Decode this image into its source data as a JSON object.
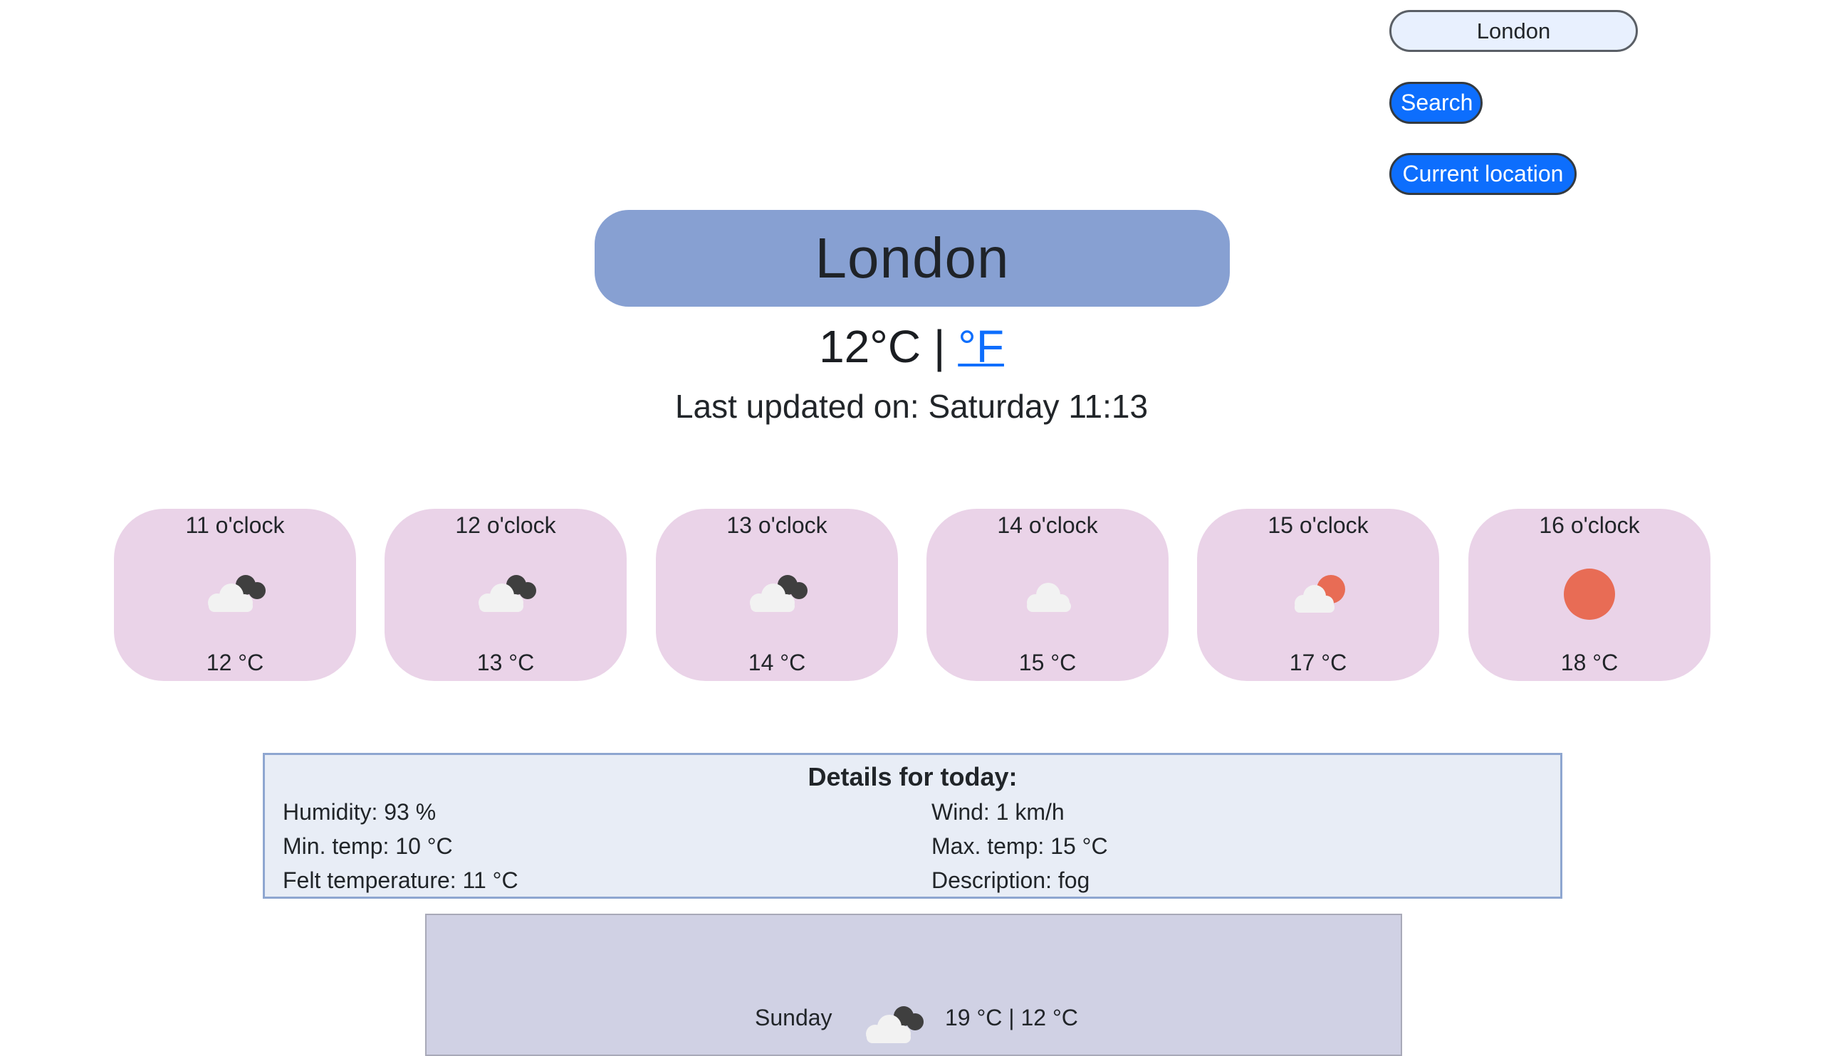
{
  "search": {
    "value": "London",
    "button_label": "Search",
    "location_button_label": "Current location"
  },
  "header": {
    "city": "London",
    "temperature": "12°C",
    "separator": " | ",
    "fahrenheit_link": "°F",
    "last_updated": "Last updated on: Saturday 11:13"
  },
  "hourly": [
    {
      "time": "11 o'clock",
      "icon": "cloud-dark-icon",
      "temp": "12 °C"
    },
    {
      "time": "12 o'clock",
      "icon": "cloud-dark-icon",
      "temp": "13 °C"
    },
    {
      "time": "13 o'clock",
      "icon": "cloud-dark-icon",
      "temp": "14 °C"
    },
    {
      "time": "14 o'clock",
      "icon": "cloud-icon",
      "temp": "15 °C"
    },
    {
      "time": "15 o'clock",
      "icon": "sun-cloud-icon",
      "temp": "17 °C"
    },
    {
      "time": "16 o'clock",
      "icon": "sun-icon",
      "temp": "18 °C"
    }
  ],
  "details": {
    "title": "Details for today:",
    "humidity": "Humidity: 93 %",
    "wind": "Wind: 1 km/h",
    "min_temp": "Min. temp: 10 °C",
    "max_temp": "Max. temp: 15 °C",
    "felt_temp": "Felt temperature: 11 °C",
    "description": "Description: fog"
  },
  "forecast": [
    {
      "day": "Sunday",
      "icon": "cloud-dark-icon",
      "temps": "19 °C | 12 °C"
    }
  ],
  "colors": {
    "accent": "#0d6efd",
    "banner": "#87a0d2",
    "hour_card": "#ead3e8",
    "details_bg": "#e8edf6",
    "forecast_bg": "#d0d1e4",
    "sun": "#e86c55"
  }
}
